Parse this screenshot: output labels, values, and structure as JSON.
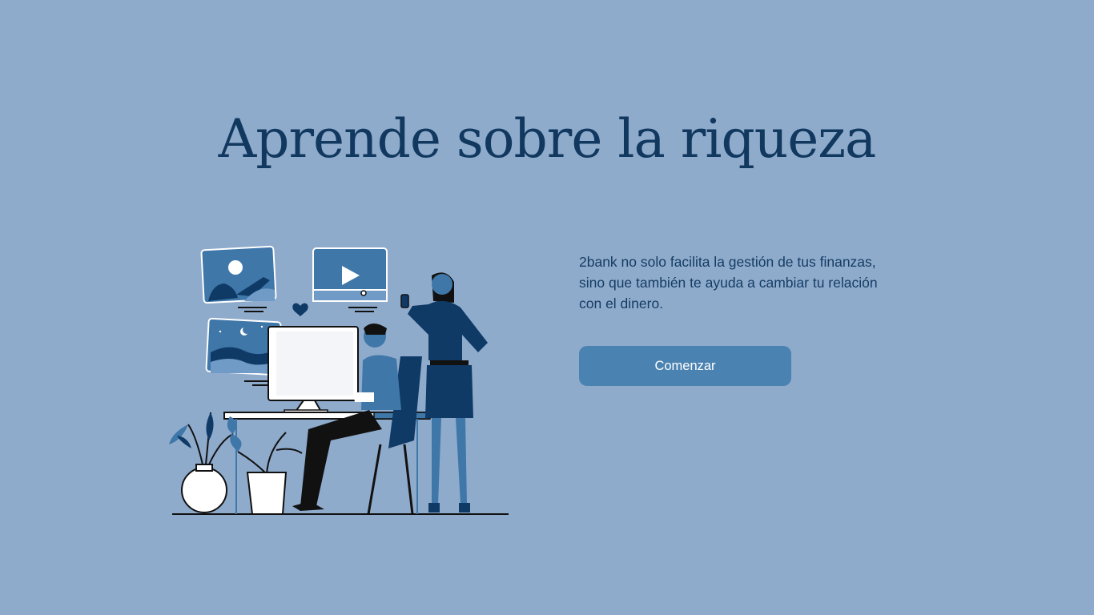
{
  "hero": {
    "title": "Aprende sobre la riqueza",
    "description": "2bank no solo facilita la gestión de tus finanzas, sino que también te ayuda a cambiar tu relación con el dinero.",
    "cta_label": "Comenzar"
  },
  "illustration": {
    "semantic": "people-working-at-computer-illustration",
    "elements": [
      "video-thumbnail-person",
      "video-play-card",
      "heart-icon",
      "night-landscape-card",
      "desktop-monitor",
      "seated-man",
      "standing-woman-with-phone",
      "potted-plants",
      "desk"
    ]
  },
  "colors": {
    "background": "#8fabcc",
    "title": "#11385e",
    "text": "#153d63",
    "button": "#4a82b1",
    "button_text": "#ffffff",
    "illustration_dark": "#0f3a66",
    "illustration_mid": "#3f77a9",
    "illustration_light": "#ffffff"
  }
}
